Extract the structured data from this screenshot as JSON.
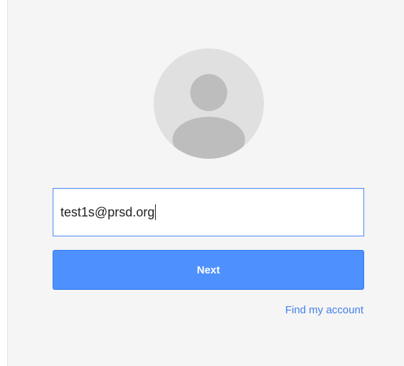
{
  "signin": {
    "avatar_icon": "default-user-avatar-icon",
    "email_value": "test1s@prsd.org",
    "next_label": "Next",
    "find_account_label": "Find my account"
  },
  "colors": {
    "card_background": "#f5f5f5",
    "accent_blue": "#4d90fe",
    "link_blue": "#427fed",
    "avatar_gray": "#bdbdbd"
  }
}
